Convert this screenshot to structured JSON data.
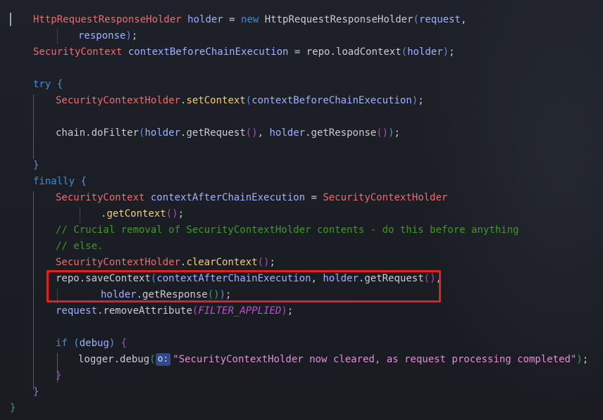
{
  "editor": {
    "lines": [
      {
        "tokens": [
          {
            "t": "HttpRequestResponseHolder",
            "c": "cls"
          },
          {
            "t": " ",
            "c": "txt"
          },
          {
            "t": "holder",
            "c": "var"
          },
          {
            "t": " = ",
            "c": "txt"
          },
          {
            "t": "new",
            "c": "kw"
          },
          {
            "t": " HttpRequestResponseHolder",
            "c": "txt"
          },
          {
            "t": "(",
            "c": "pv"
          },
          {
            "t": "request",
            "c": "var"
          },
          {
            "t": ",",
            "c": "txt"
          }
        ]
      },
      {
        "tokens": [
          {
            "t": "response",
            "c": "var"
          },
          {
            "t": ")",
            "c": "pv"
          },
          {
            "t": ";",
            "c": "txt"
          }
        ]
      },
      {
        "tokens": [
          {
            "t": "SecurityContext",
            "c": "cls"
          },
          {
            "t": " ",
            "c": "txt"
          },
          {
            "t": "contextBeforeChainExecution",
            "c": "var"
          },
          {
            "t": " = ",
            "c": "txt"
          },
          {
            "t": "repo",
            "c": "txt"
          },
          {
            "t": ".",
            "c": "txt"
          },
          {
            "t": "loadContext",
            "c": "txt"
          },
          {
            "t": "(",
            "c": "pv"
          },
          {
            "t": "holder",
            "c": "var"
          },
          {
            "t": ")",
            "c": "pv"
          },
          {
            "t": ";",
            "c": "txt"
          }
        ]
      },
      {
        "tokens": [
          {
            "t": "try",
            "c": "kw"
          },
          {
            "t": " ",
            "c": "txt"
          },
          {
            "t": "{",
            "c": "pv"
          }
        ]
      },
      {
        "tokens": [
          {
            "t": "SecurityContextHolder",
            "c": "cls"
          },
          {
            "t": ".",
            "c": "txt"
          },
          {
            "t": "setContext",
            "c": "fn"
          },
          {
            "t": "(",
            "c": "pv"
          },
          {
            "t": "contextBeforeChainExecution",
            "c": "var"
          },
          {
            "t": ")",
            "c": "pv"
          },
          {
            "t": ";",
            "c": "txt"
          }
        ]
      },
      {
        "tokens": [
          {
            "t": "chain",
            "c": "txt"
          },
          {
            "t": ".",
            "c": "txt"
          },
          {
            "t": "doFilter",
            "c": "txt"
          },
          {
            "t": "(",
            "c": "pv"
          },
          {
            "t": "holder",
            "c": "var"
          },
          {
            "t": ".",
            "c": "txt"
          },
          {
            "t": "getRequest",
            "c": "txt"
          },
          {
            "t": "()",
            "c": "pb"
          },
          {
            "t": ", ",
            "c": "txt"
          },
          {
            "t": "holder",
            "c": "var"
          },
          {
            "t": ".",
            "c": "txt"
          },
          {
            "t": "getResponse",
            "c": "txt"
          },
          {
            "t": "()",
            "c": "pb"
          },
          {
            "t": ")",
            "c": "pv"
          },
          {
            "t": ";",
            "c": "txt"
          }
        ]
      },
      {
        "tokens": [
          {
            "t": "}",
            "c": "pv"
          }
        ]
      },
      {
        "tokens": [
          {
            "t": "finally",
            "c": "kw"
          },
          {
            "t": " ",
            "c": "txt"
          },
          {
            "t": "{",
            "c": "pv"
          }
        ]
      },
      {
        "tokens": [
          {
            "t": "SecurityContext",
            "c": "cls"
          },
          {
            "t": " ",
            "c": "txt"
          },
          {
            "t": "contextAfterChainExecution",
            "c": "var"
          },
          {
            "t": " = ",
            "c": "txt"
          },
          {
            "t": "SecurityContextHolder",
            "c": "cls"
          }
        ]
      },
      {
        "tokens": [
          {
            "t": ".",
            "c": "txt"
          },
          {
            "t": "getContext",
            "c": "fn"
          },
          {
            "t": "()",
            "c": "pb"
          },
          {
            "t": ";",
            "c": "txt"
          }
        ]
      },
      {
        "tokens": [
          {
            "t": "// Crucial removal of SecurityContextHolder contents - do this before anything",
            "c": "comment"
          }
        ]
      },
      {
        "tokens": [
          {
            "t": "// else.",
            "c": "comment"
          }
        ]
      },
      {
        "tokens": [
          {
            "t": "SecurityContextHolder",
            "c": "cls"
          },
          {
            "t": ".",
            "c": "txt"
          },
          {
            "t": "clearContext",
            "c": "fn"
          },
          {
            "t": "()",
            "c": "pb"
          },
          {
            "t": ";",
            "c": "txt"
          }
        ]
      },
      {
        "tokens": [
          {
            "t": "repo",
            "c": "txt"
          },
          {
            "t": ".",
            "c": "txt"
          },
          {
            "t": "saveContext",
            "c": "txt"
          },
          {
            "t": "(",
            "c": "pv"
          },
          {
            "t": "contextAfterChainExecution",
            "c": "var"
          },
          {
            "t": ", ",
            "c": "txt"
          },
          {
            "t": "holder",
            "c": "var"
          },
          {
            "t": ".",
            "c": "txt"
          },
          {
            "t": "getRequest",
            "c": "txt"
          },
          {
            "t": "()",
            "c": "pb"
          },
          {
            "t": ",",
            "c": "txt"
          }
        ]
      },
      {
        "tokens": [
          {
            "t": "holder",
            "c": "var"
          },
          {
            "t": ".",
            "c": "txt"
          },
          {
            "t": "getResponse",
            "c": "txt"
          },
          {
            "t": "()",
            "c": "pg"
          },
          {
            "t": ")",
            "c": "pv"
          },
          {
            "t": ";",
            "c": "txt"
          }
        ]
      },
      {
        "tokens": [
          {
            "t": "request",
            "c": "var"
          },
          {
            "t": ".",
            "c": "txt"
          },
          {
            "t": "removeAttribute",
            "c": "txt"
          },
          {
            "t": "(",
            "c": "pb"
          },
          {
            "t": "FILTER_APPLIED",
            "c": "konst"
          },
          {
            "t": ")",
            "c": "pb"
          },
          {
            "t": ";",
            "c": "txt"
          }
        ]
      },
      {
        "tokens": [
          {
            "t": "if",
            "c": "kw"
          },
          {
            "t": " ",
            "c": "txt"
          },
          {
            "t": "(",
            "c": "pv"
          },
          {
            "t": "debug",
            "c": "var"
          },
          {
            "t": ")",
            "c": "pv"
          },
          {
            "t": " ",
            "c": "txt"
          },
          {
            "t": "{",
            "c": "pb"
          }
        ]
      },
      {
        "tokens": [
          {
            "t": "logger",
            "c": "txt"
          },
          {
            "t": ".",
            "c": "txt"
          },
          {
            "t": "debug",
            "c": "txt"
          },
          {
            "t": "(",
            "c": "pg"
          },
          {
            "t": "o:",
            "c": "hint"
          },
          {
            "t": "\"SecurityContextHolder now cleared, as request processing completed\"",
            "c": "str"
          },
          {
            "t": ")",
            "c": "pg"
          },
          {
            "t": ";",
            "c": "txt"
          }
        ]
      },
      {
        "tokens": [
          {
            "t": "}",
            "c": "pb"
          }
        ]
      },
      {
        "tokens": [
          {
            "t": "}",
            "c": "pv"
          }
        ]
      },
      {
        "tokens": [
          {
            "t": "}",
            "c": "pg"
          }
        ]
      }
    ]
  }
}
